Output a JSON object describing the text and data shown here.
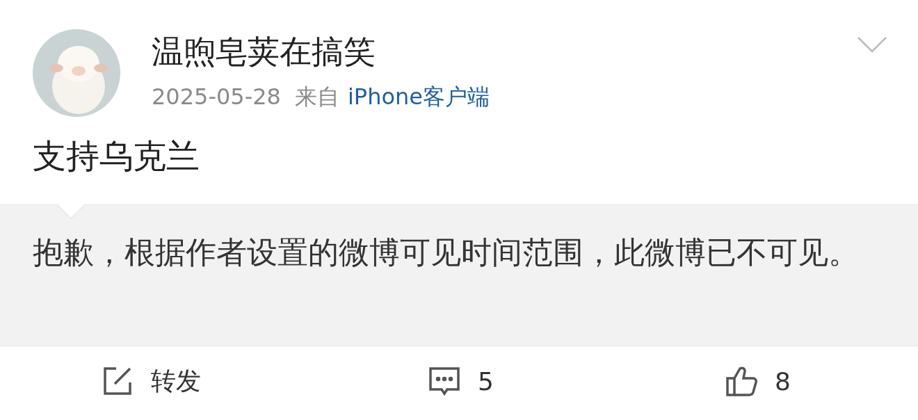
{
  "post": {
    "author": "温煦皂荚在搞笑",
    "date": "2025-05-28",
    "source_prefix": "来自",
    "source": "iPhone客户端",
    "text": "支持乌克兰"
  },
  "notice": "抱歉，根据作者设置的微博可见时间范围，此微博已不可见。",
  "actions": [
    {
      "kind": "repost",
      "label": "转发"
    },
    {
      "kind": "comment",
      "label": "5"
    },
    {
      "kind": "like",
      "label": "8"
    }
  ]
}
